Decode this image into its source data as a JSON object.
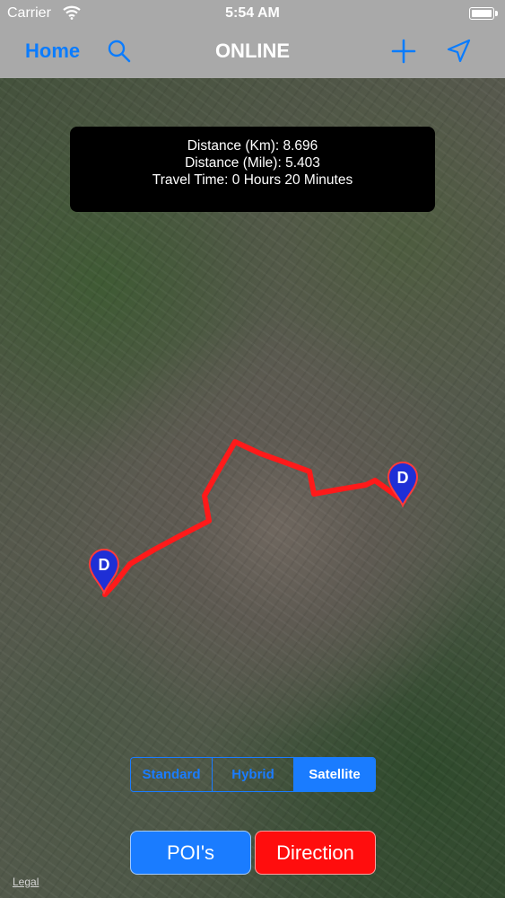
{
  "status_bar": {
    "carrier": "Carrier",
    "time": "5:54 AM"
  },
  "nav": {
    "home_label": "Home",
    "title": "ONLINE",
    "accent_color": "#0a7cff"
  },
  "info": {
    "distance_km": "Distance (Km): 8.696",
    "distance_mile": "Distance (Mile): 5.403",
    "travel_time": "Travel Time: 0 Hours 20 Minutes"
  },
  "pins": {
    "start_label": "D",
    "end_label": "D",
    "pin_color": "#1e2fd6"
  },
  "route": {
    "color": "#ff1a1a"
  },
  "map_type": {
    "options": [
      "Standard",
      "Hybrid",
      "Satellite"
    ],
    "selected": "Satellite"
  },
  "buttons": {
    "poi": "POI's",
    "direction": "Direction"
  },
  "legal": "Legal"
}
